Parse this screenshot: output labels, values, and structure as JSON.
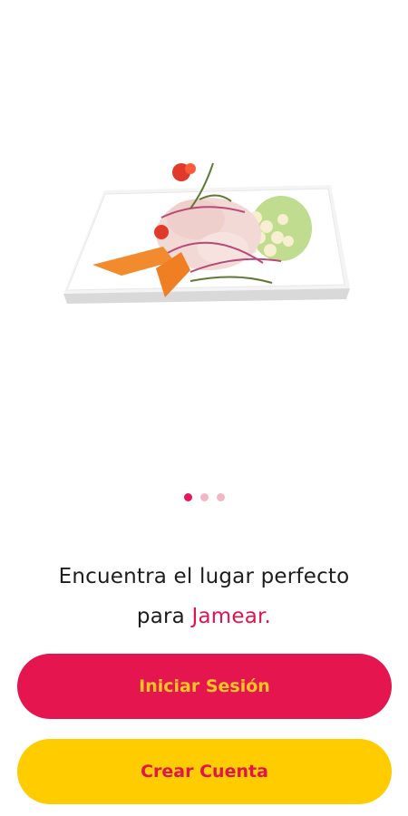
{
  "carousel": {
    "dot_count": 3,
    "active_index": 0
  },
  "headline": {
    "line1": "Encuentra el lugar perfecto",
    "line2_prefix": "para ",
    "line2_accent": "Jamear."
  },
  "buttons": {
    "login_label": "Iniciar Sesión",
    "signup_label": "Crear Cuenta"
  },
  "colors": {
    "primary": "#e5164f",
    "secondary": "#ffcc00"
  }
}
